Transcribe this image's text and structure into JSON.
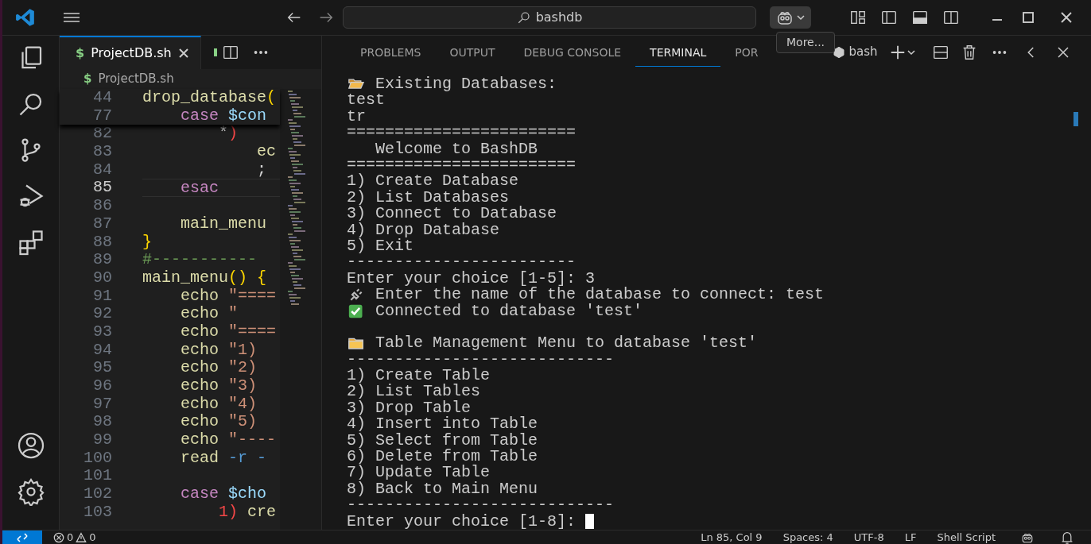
{
  "title_bar": {
    "search": {
      "value": "bashdb"
    },
    "tooltip": "More..."
  },
  "activity_bar": {
    "items": [
      {
        "kind": "explorer"
      },
      {
        "kind": "search"
      },
      {
        "kind": "source-control"
      },
      {
        "kind": "run-debug"
      },
      {
        "kind": "extensions"
      }
    ],
    "bottom": [
      {
        "kind": "account"
      },
      {
        "kind": "settings"
      }
    ]
  },
  "editor": {
    "tabs": [
      {
        "icon": "$",
        "label": "ProjectDB.sh",
        "selected": true
      },
      {
        "selected": false
      }
    ],
    "breadcrumb": {
      "icon": "$",
      "label": "ProjectDB.sh"
    },
    "sticky_lines": [
      {
        "number": "44",
        "tokens": [
          {
            "text": "drop_database",
            "kind": "fn"
          },
          {
            "text": "(",
            "kind": "brace"
          }
        ]
      },
      {
        "number": "77",
        "tokens": [
          {
            "text": "    case ",
            "kind": "kw"
          },
          {
            "text": "$con",
            "kind": "var"
          }
        ]
      }
    ],
    "lines": [
      {
        "number": "82",
        "current": false,
        "tokens": [
          {
            "text": "        *",
            "kind": "plain"
          },
          {
            "text": ")",
            "kind": "red"
          }
        ]
      },
      {
        "number": "83",
        "current": false,
        "tokens": [
          {
            "text": "            ec",
            "kind": "fn"
          }
        ]
      },
      {
        "number": "84",
        "current": false,
        "tokens": [
          {
            "text": "            ;",
            "kind": "plain"
          }
        ]
      },
      {
        "number": "85",
        "current": true,
        "tokens": [
          {
            "text": "    esac",
            "kind": "kw"
          }
        ]
      },
      {
        "number": "86",
        "current": false
      },
      {
        "number": "87",
        "current": false,
        "tokens": [
          {
            "text": "    main_menu",
            "kind": "fn"
          }
        ]
      },
      {
        "number": "88",
        "current": false,
        "tokens": [
          {
            "text": "}",
            "kind": "brace"
          }
        ]
      },
      {
        "number": "89",
        "current": false,
        "tokens": [
          {
            "text": "#-----------",
            "kind": "comment"
          }
        ]
      },
      {
        "number": "90",
        "current": false,
        "tokens": [
          {
            "text": "main_menu",
            "kind": "fn"
          },
          {
            "text": "() {",
            "kind": "brace"
          }
        ]
      },
      {
        "number": "91",
        "current": false,
        "tokens": [
          {
            "text": "    echo ",
            "kind": "fn"
          },
          {
            "text": "\"====",
            "kind": "str"
          }
        ]
      },
      {
        "number": "92",
        "current": false,
        "tokens": [
          {
            "text": "    echo ",
            "kind": "fn"
          },
          {
            "text": "\"",
            "kind": "str"
          }
        ]
      },
      {
        "number": "93",
        "current": false,
        "tokens": [
          {
            "text": "    echo ",
            "kind": "fn"
          },
          {
            "text": "\"====",
            "kind": "str"
          }
        ]
      },
      {
        "number": "94",
        "current": false,
        "tokens": [
          {
            "text": "    echo ",
            "kind": "fn"
          },
          {
            "text": "\"1)",
            "kind": "str"
          }
        ]
      },
      {
        "number": "95",
        "current": false,
        "tokens": [
          {
            "text": "    echo ",
            "kind": "fn"
          },
          {
            "text": "\"2)",
            "kind": "str"
          }
        ]
      },
      {
        "number": "96",
        "current": false,
        "tokens": [
          {
            "text": "    echo ",
            "kind": "fn"
          },
          {
            "text": "\"3)",
            "kind": "str"
          }
        ]
      },
      {
        "number": "97",
        "current": false,
        "tokens": [
          {
            "text": "    echo ",
            "kind": "fn"
          },
          {
            "text": "\"4)",
            "kind": "str"
          }
        ]
      },
      {
        "number": "98",
        "current": false,
        "tokens": [
          {
            "text": "    echo ",
            "kind": "fn"
          },
          {
            "text": "\"5)",
            "kind": "str"
          }
        ]
      },
      {
        "number": "99",
        "current": false,
        "tokens": [
          {
            "text": "    echo ",
            "kind": "fn"
          },
          {
            "text": "\"----",
            "kind": "str"
          }
        ]
      },
      {
        "number": "100",
        "current": false,
        "tokens": [
          {
            "text": "    read ",
            "kind": "fn"
          },
          {
            "text": "-r -",
            "kind": "opt"
          }
        ]
      },
      {
        "number": "101",
        "current": false
      },
      {
        "number": "102",
        "current": false,
        "tokens": [
          {
            "text": "    case ",
            "kind": "kw"
          },
          {
            "text": "$cho",
            "kind": "var"
          }
        ]
      },
      {
        "number": "103",
        "current": false,
        "tokens": [
          {
            "text": "        1) ",
            "kind": "red"
          },
          {
            "text": "cre",
            "kind": "fn"
          }
        ]
      }
    ]
  },
  "panel": {
    "tabs": [
      {
        "label": "PROBLEMS",
        "selected": false
      },
      {
        "label": "OUTPUT",
        "selected": false
      },
      {
        "label": "DEBUG CONSOLE",
        "selected": false
      },
      {
        "label": "TERMINAL",
        "selected": true
      },
      {
        "label": "POR",
        "selected": false
      }
    ],
    "terminal_name": "bash",
    "lines": [
      {
        "kind": "folder-open",
        "text": "Existing Databases:"
      },
      {
        "kind": "text",
        "text": "test"
      },
      {
        "kind": "text",
        "text": "tr"
      },
      {
        "kind": "text",
        "text": "========================"
      },
      {
        "kind": "text",
        "text": "   Welcome to BashDB"
      },
      {
        "kind": "text",
        "text": "========================"
      },
      {
        "kind": "text",
        "text": "1) Create Database"
      },
      {
        "kind": "text",
        "text": "2) List Databases"
      },
      {
        "kind": "text",
        "text": "3) Connect to Database"
      },
      {
        "kind": "text",
        "text": "4) Drop Database"
      },
      {
        "kind": "text",
        "text": "5) Exit"
      },
      {
        "kind": "text",
        "text": "------------------------"
      },
      {
        "kind": "text",
        "text": "Enter your choice [1-5]: 3"
      },
      {
        "kind": "plug",
        "text": "Enter the name of the database to connect: test"
      },
      {
        "kind": "check",
        "text": "Connected to database 'test'"
      },
      {
        "kind": "blank"
      },
      {
        "kind": "folder",
        "text": "Table Management Menu to database 'test'"
      },
      {
        "kind": "text",
        "text": "----------------------------"
      },
      {
        "kind": "text",
        "text": "1) Create Table"
      },
      {
        "kind": "text",
        "text": "2) List Tables"
      },
      {
        "kind": "text",
        "text": "3) Drop Table"
      },
      {
        "kind": "text",
        "text": "4) Insert into Table"
      },
      {
        "kind": "text",
        "text": "5) Select from Table"
      },
      {
        "kind": "text",
        "text": "6) Delete from Table"
      },
      {
        "kind": "text",
        "text": "7) Update Table"
      },
      {
        "kind": "text",
        "text": "8) Back to Main Menu"
      },
      {
        "kind": "text",
        "text": "----------------------------"
      },
      {
        "kind": "prompt",
        "text": "Enter your choice [1-8]:"
      }
    ]
  },
  "status_bar": {
    "errors": "0",
    "warnings": "0",
    "items": [
      "Ln 85, Col 9",
      "Spaces: 4",
      "UTF-8",
      "LF",
      "Shell Script"
    ]
  }
}
